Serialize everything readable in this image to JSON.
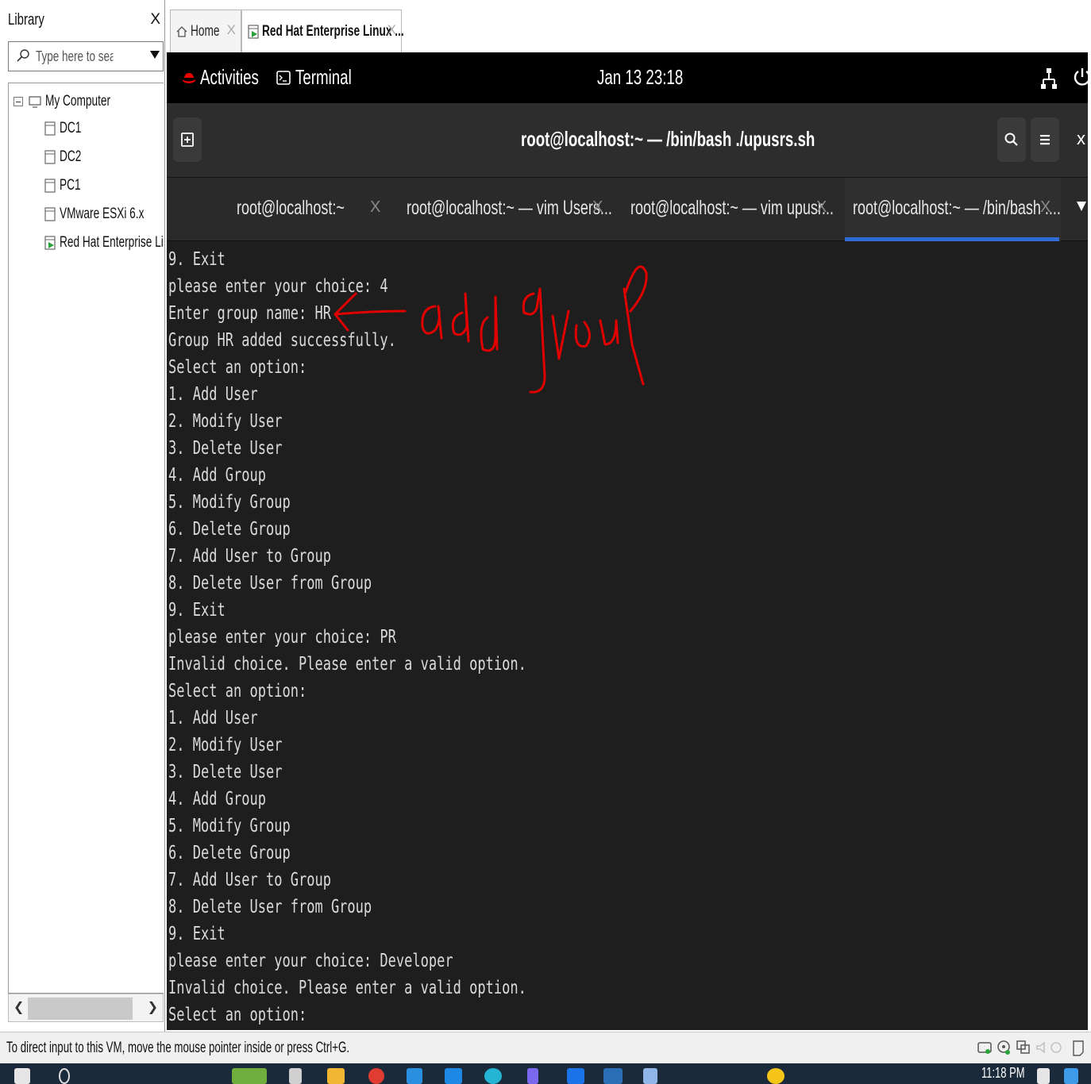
{
  "library": {
    "title": "Library",
    "close": "X",
    "search_placeholder": "Type here to search",
    "tree": {
      "root": "My Computer",
      "items": [
        "DC1",
        "DC2",
        "PC1",
        "VMware ESXi 6.x",
        "Red Hat Enterprise Linux"
      ]
    }
  },
  "tabs": {
    "home": "Home",
    "vm": "Red Hat Enterprise Linux ...",
    "close": "X"
  },
  "gnome": {
    "activities": "Activities",
    "app": "Terminal",
    "clock": "Jan 13  23:18"
  },
  "terminal": {
    "title": "root@localhost:~ — /bin/bash ./upusrs.sh",
    "close": "x",
    "tabs": [
      {
        "label": "root@localhost:~"
      },
      {
        "label": "root@localhost:~ — vim Users..."
      },
      {
        "label": "root@localhost:~ — vim upusr..."
      },
      {
        "label": "root@localhost:~ — /bin/bash ...."
      }
    ],
    "tab_close": "X",
    "lines": [
      "9. Exit",
      "please enter your choice: 4",
      "Enter group name: HR",
      "Group HR added successfully.",
      "Select an option:",
      "1. Add User",
      "2. Modify User",
      "3. Delete User",
      "4. Add Group",
      "5. Modify Group",
      "6. Delete Group",
      "7. Add User to Group",
      "8. Delete User from Group",
      "9. Exit",
      "please enter your choice: PR",
      "Invalid choice. Please enter a valid option.",
      "Select an option:",
      "1. Add User",
      "2. Modify User",
      "3. Delete User",
      "4. Add Group",
      "5. Modify Group",
      "6. Delete Group",
      "7. Add User to Group",
      "8. Delete User from Group",
      "9. Exit",
      "please enter your choice: Developer",
      "Invalid choice. Please enter a valid option.",
      "Select an option:"
    ]
  },
  "status": {
    "text": "To direct input to this VM, move the mouse pointer inside or press Ctrl+G."
  },
  "taskbar": {
    "time": "11:18 PM"
  },
  "colors": {
    "terminal_bg": "#1e1e1e",
    "gnome_bar": "#000000",
    "active_tab_indicator": "#2f6bd4",
    "annotation": "#e00000"
  }
}
